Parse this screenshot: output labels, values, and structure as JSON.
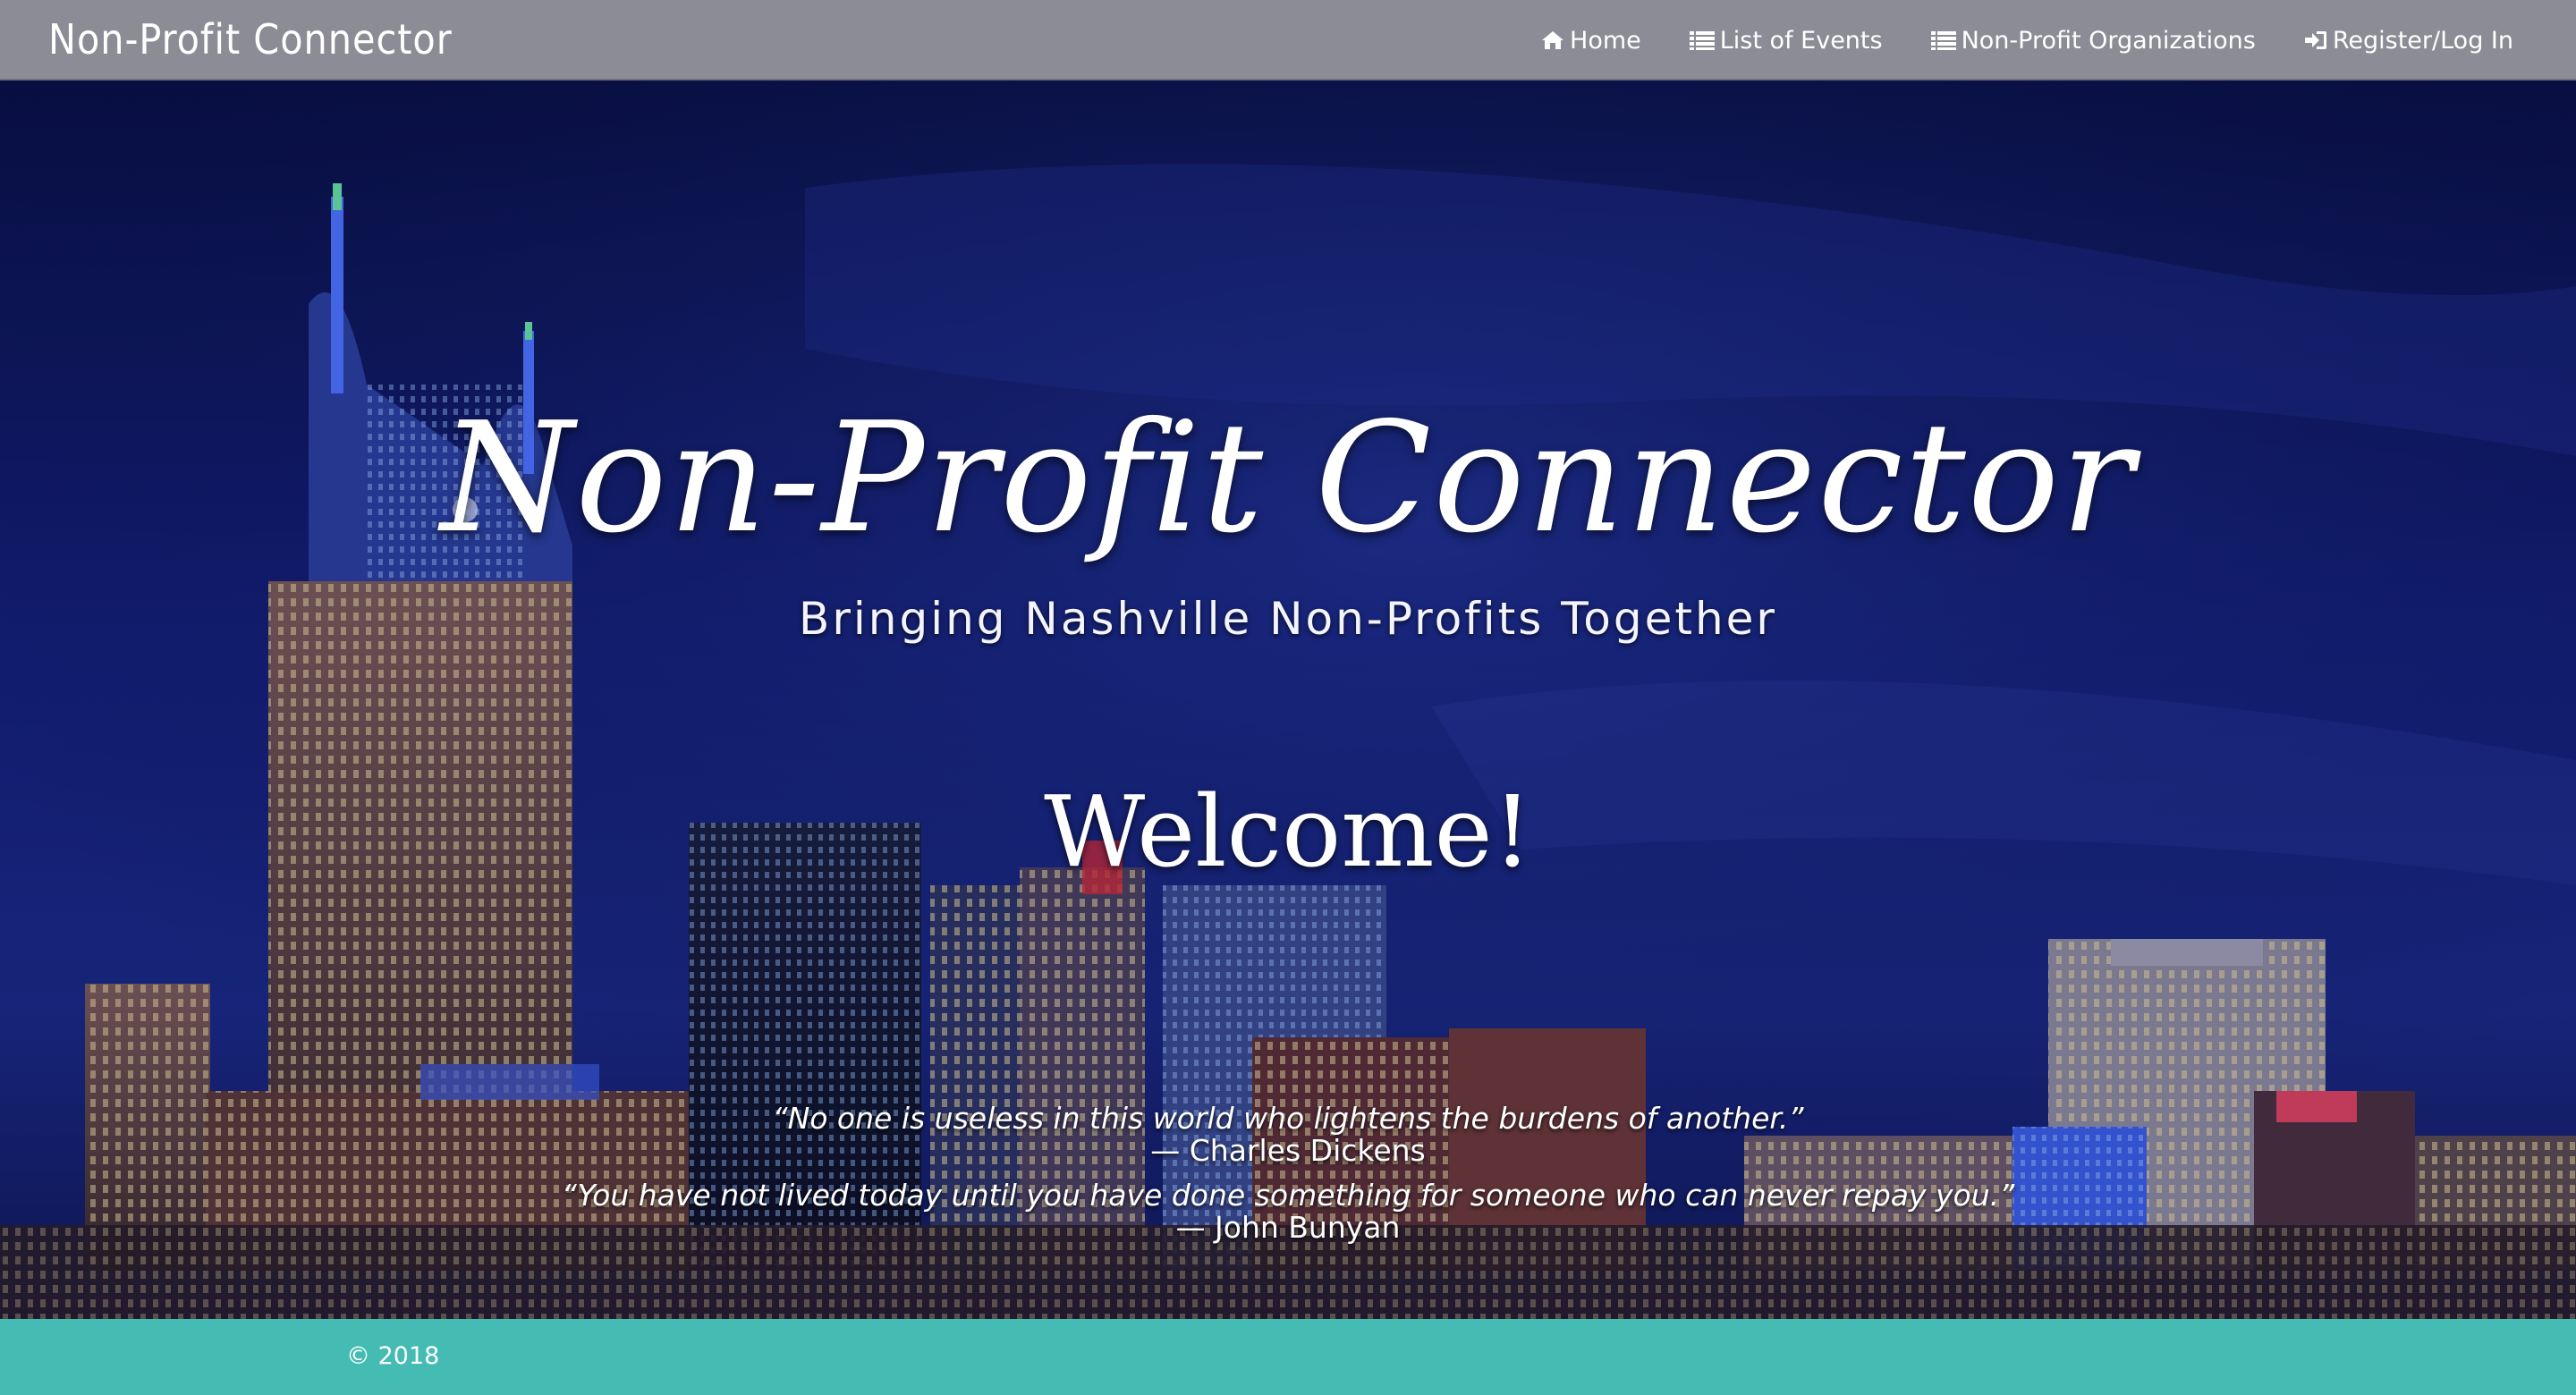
{
  "navbar": {
    "brand": "Non-Profit Connector",
    "links": [
      {
        "label": "Home",
        "icon": "home-icon"
      },
      {
        "label": "List of Events",
        "icon": "list-icon"
      },
      {
        "label": "Non-Profit Organizations",
        "icon": "list-icon"
      },
      {
        "label": "Register/Log In",
        "icon": "sign-in-icon"
      }
    ]
  },
  "hero": {
    "title": "Non-Profit Connector",
    "subtitle": "Bringing Nashville Non-Profits Together",
    "welcome": "Welcome!",
    "quotes": [
      {
        "text": "“No one is useless in this world who lightens the burdens of another.”",
        "author": "— Charles Dickens"
      },
      {
        "text": "“You have not lived today until you have done something for someone who can never repay you.”",
        "author": "— John Bunyan"
      }
    ],
    "background": "Nashville skyline at night"
  },
  "footer": {
    "copyright": "© 2018"
  },
  "colors": {
    "navbar": "#8c8c96",
    "footer": "#45bcb3",
    "sky": "#0b1240",
    "text": "#ffffff"
  }
}
